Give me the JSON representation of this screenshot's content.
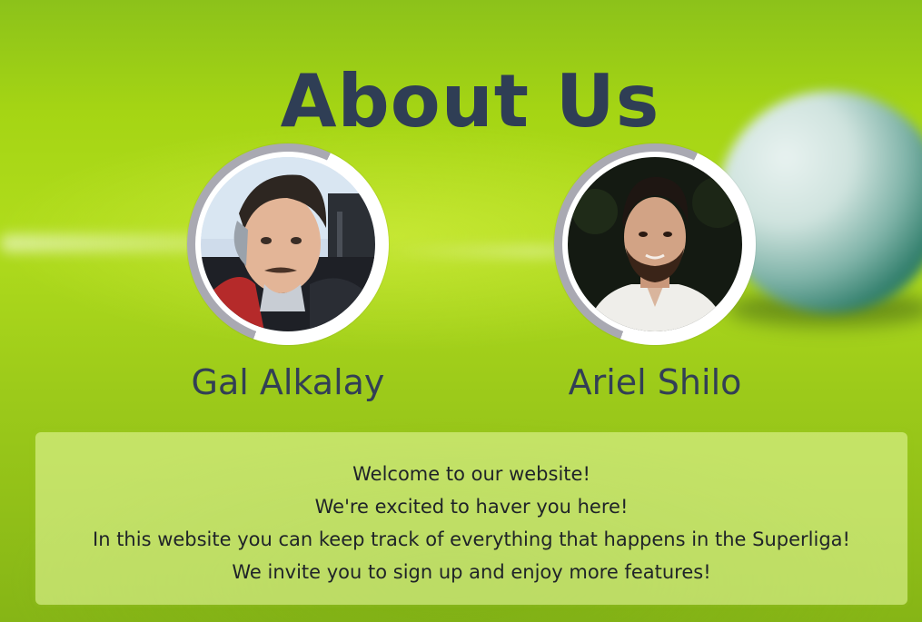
{
  "page": {
    "title": "About Us"
  },
  "team": [
    {
      "name": "Gal Alkalay",
      "avatar_icon": "avatar-photo"
    },
    {
      "name": "Ariel Shilo",
      "avatar_icon": "avatar-photo"
    }
  ],
  "welcome": {
    "lines": [
      "Welcome to our website!",
      "We're excited to haver you here!",
      "In this website you can keep track of everything that happens in the Superliga!",
      "We invite you to sign up and enjoy more features!"
    ]
  },
  "colors": {
    "title": "#2f3e55",
    "name": "#323f55",
    "ring_grey": "#a9a9b2",
    "panel": "#e1f596"
  }
}
